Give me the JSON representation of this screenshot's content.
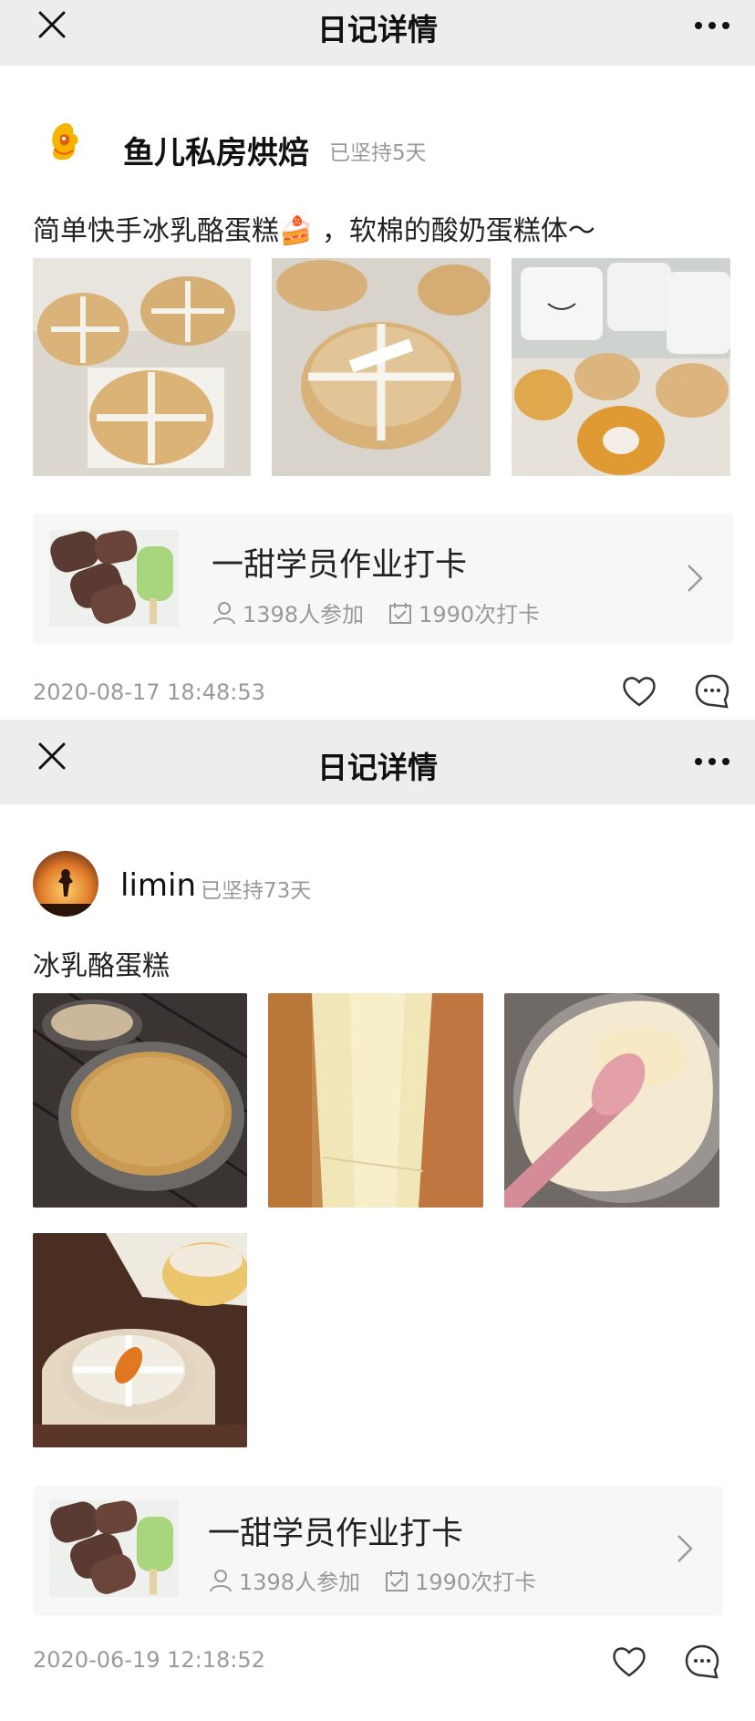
{
  "screens": [
    {
      "nav": {
        "title": "日记详情"
      },
      "user": {
        "name": "鱼儿私房烘焙",
        "persist": "已坚持5天",
        "avatar_text": "鱼儿私房烘焙"
      },
      "post_text": "简单快手冰乳酪蛋糕🍰 ，软棉的酸奶蛋糕体～",
      "photos": [
        {
          "name": "cake-boxes-photo"
        },
        {
          "name": "cake-closeup-photo"
        },
        {
          "name": "cake-packaging-photo"
        }
      ],
      "course": {
        "title": "一甜学员作业打卡",
        "participants": "1398人参加",
        "checkins": "1990次打卡"
      },
      "timestamp": "2020-08-17 18:48:53"
    },
    {
      "nav": {
        "title": "日记详情"
      },
      "user": {
        "name": "limin",
        "persist": "已坚持73天"
      },
      "post_text": "冰乳酪蛋糕",
      "photos": [
        {
          "name": "cake-pans-photo"
        },
        {
          "name": "cake-slice-photo"
        },
        {
          "name": "cream-mixing-photo"
        },
        {
          "name": "cake-wrapped-photo"
        }
      ],
      "course": {
        "title": "一甜学员作业打卡",
        "participants": "1398人参加",
        "checkins": "1990次打卡"
      },
      "timestamp": "2020-06-19 12:18:52"
    }
  ],
  "icons": [
    "close-icon",
    "more-icon",
    "person-icon",
    "calendar-check-icon",
    "chevron-right-icon",
    "heart-icon",
    "comment-icon"
  ],
  "colors": {
    "navbar_bg": "#ededed",
    "card_bg": "#f7f7f7",
    "muted_text": "#999999",
    "logo_orange": "#e89a1c"
  }
}
